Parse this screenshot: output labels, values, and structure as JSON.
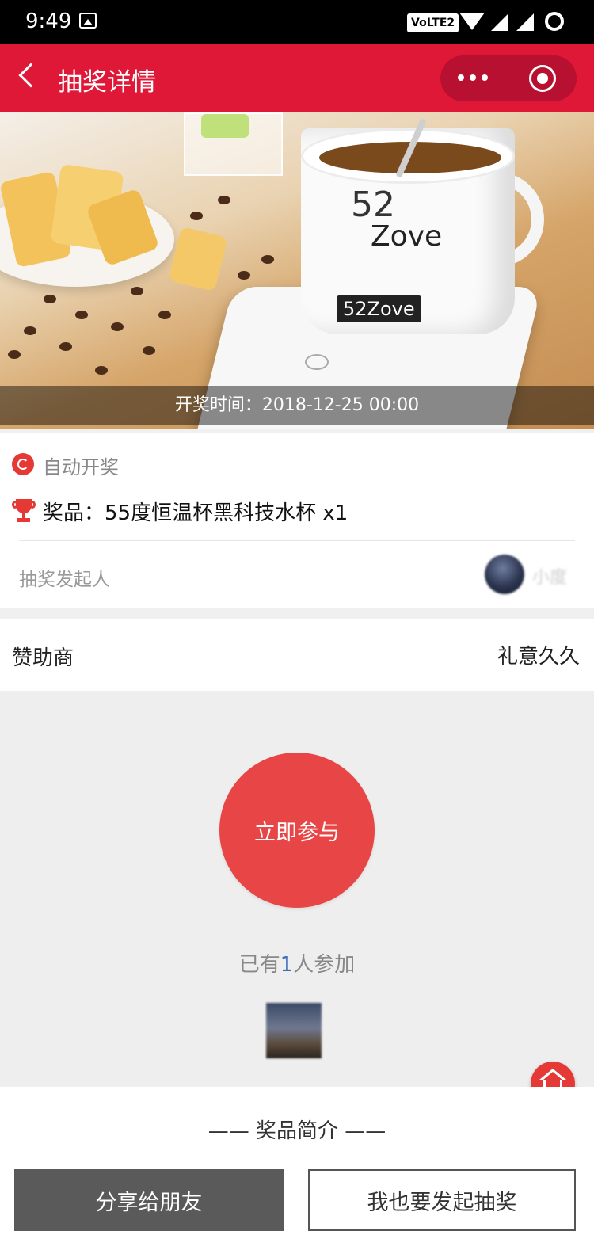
{
  "status_bar": {
    "time": "9:49",
    "network_badge": "VoLTE2",
    "icons": [
      "image-icon",
      "wifi-icon",
      "signal-icon",
      "signal-icon",
      "loading-icon"
    ]
  },
  "nav": {
    "title": "抽奖详情",
    "back_icon": "chevron-left-icon",
    "more_icon": "more-dots-icon",
    "close_icon": "target-circle-icon"
  },
  "banner": {
    "caption": "开奖时间：2018-12-25 00:00",
    "logo_top": "52",
    "logo_vertical": "Zove",
    "logo_box": "52Zove"
  },
  "info": {
    "mode_label": "自动开奖",
    "prize_text": "奖品：55度恒温杯黑科技水杯 x1",
    "initiator_label": "抽奖发起人",
    "initiator_name": "小度"
  },
  "sponsor": {
    "label": "赞助商",
    "name": "礼意久久"
  },
  "join": {
    "button_label": "立即参与",
    "count_prefix": "已有",
    "count": "1",
    "count_suffix": "人参加"
  },
  "intro": {
    "title": "—— 奖品简介 ——"
  },
  "bottom_bar": {
    "share_label": "分享给朋友",
    "start_label": "我也要发起抽奖"
  },
  "colors": {
    "nav_red": "#e01838",
    "join_red": "#e84646",
    "count_blue": "#3a6db5",
    "share_gray": "#5a5a5a"
  }
}
